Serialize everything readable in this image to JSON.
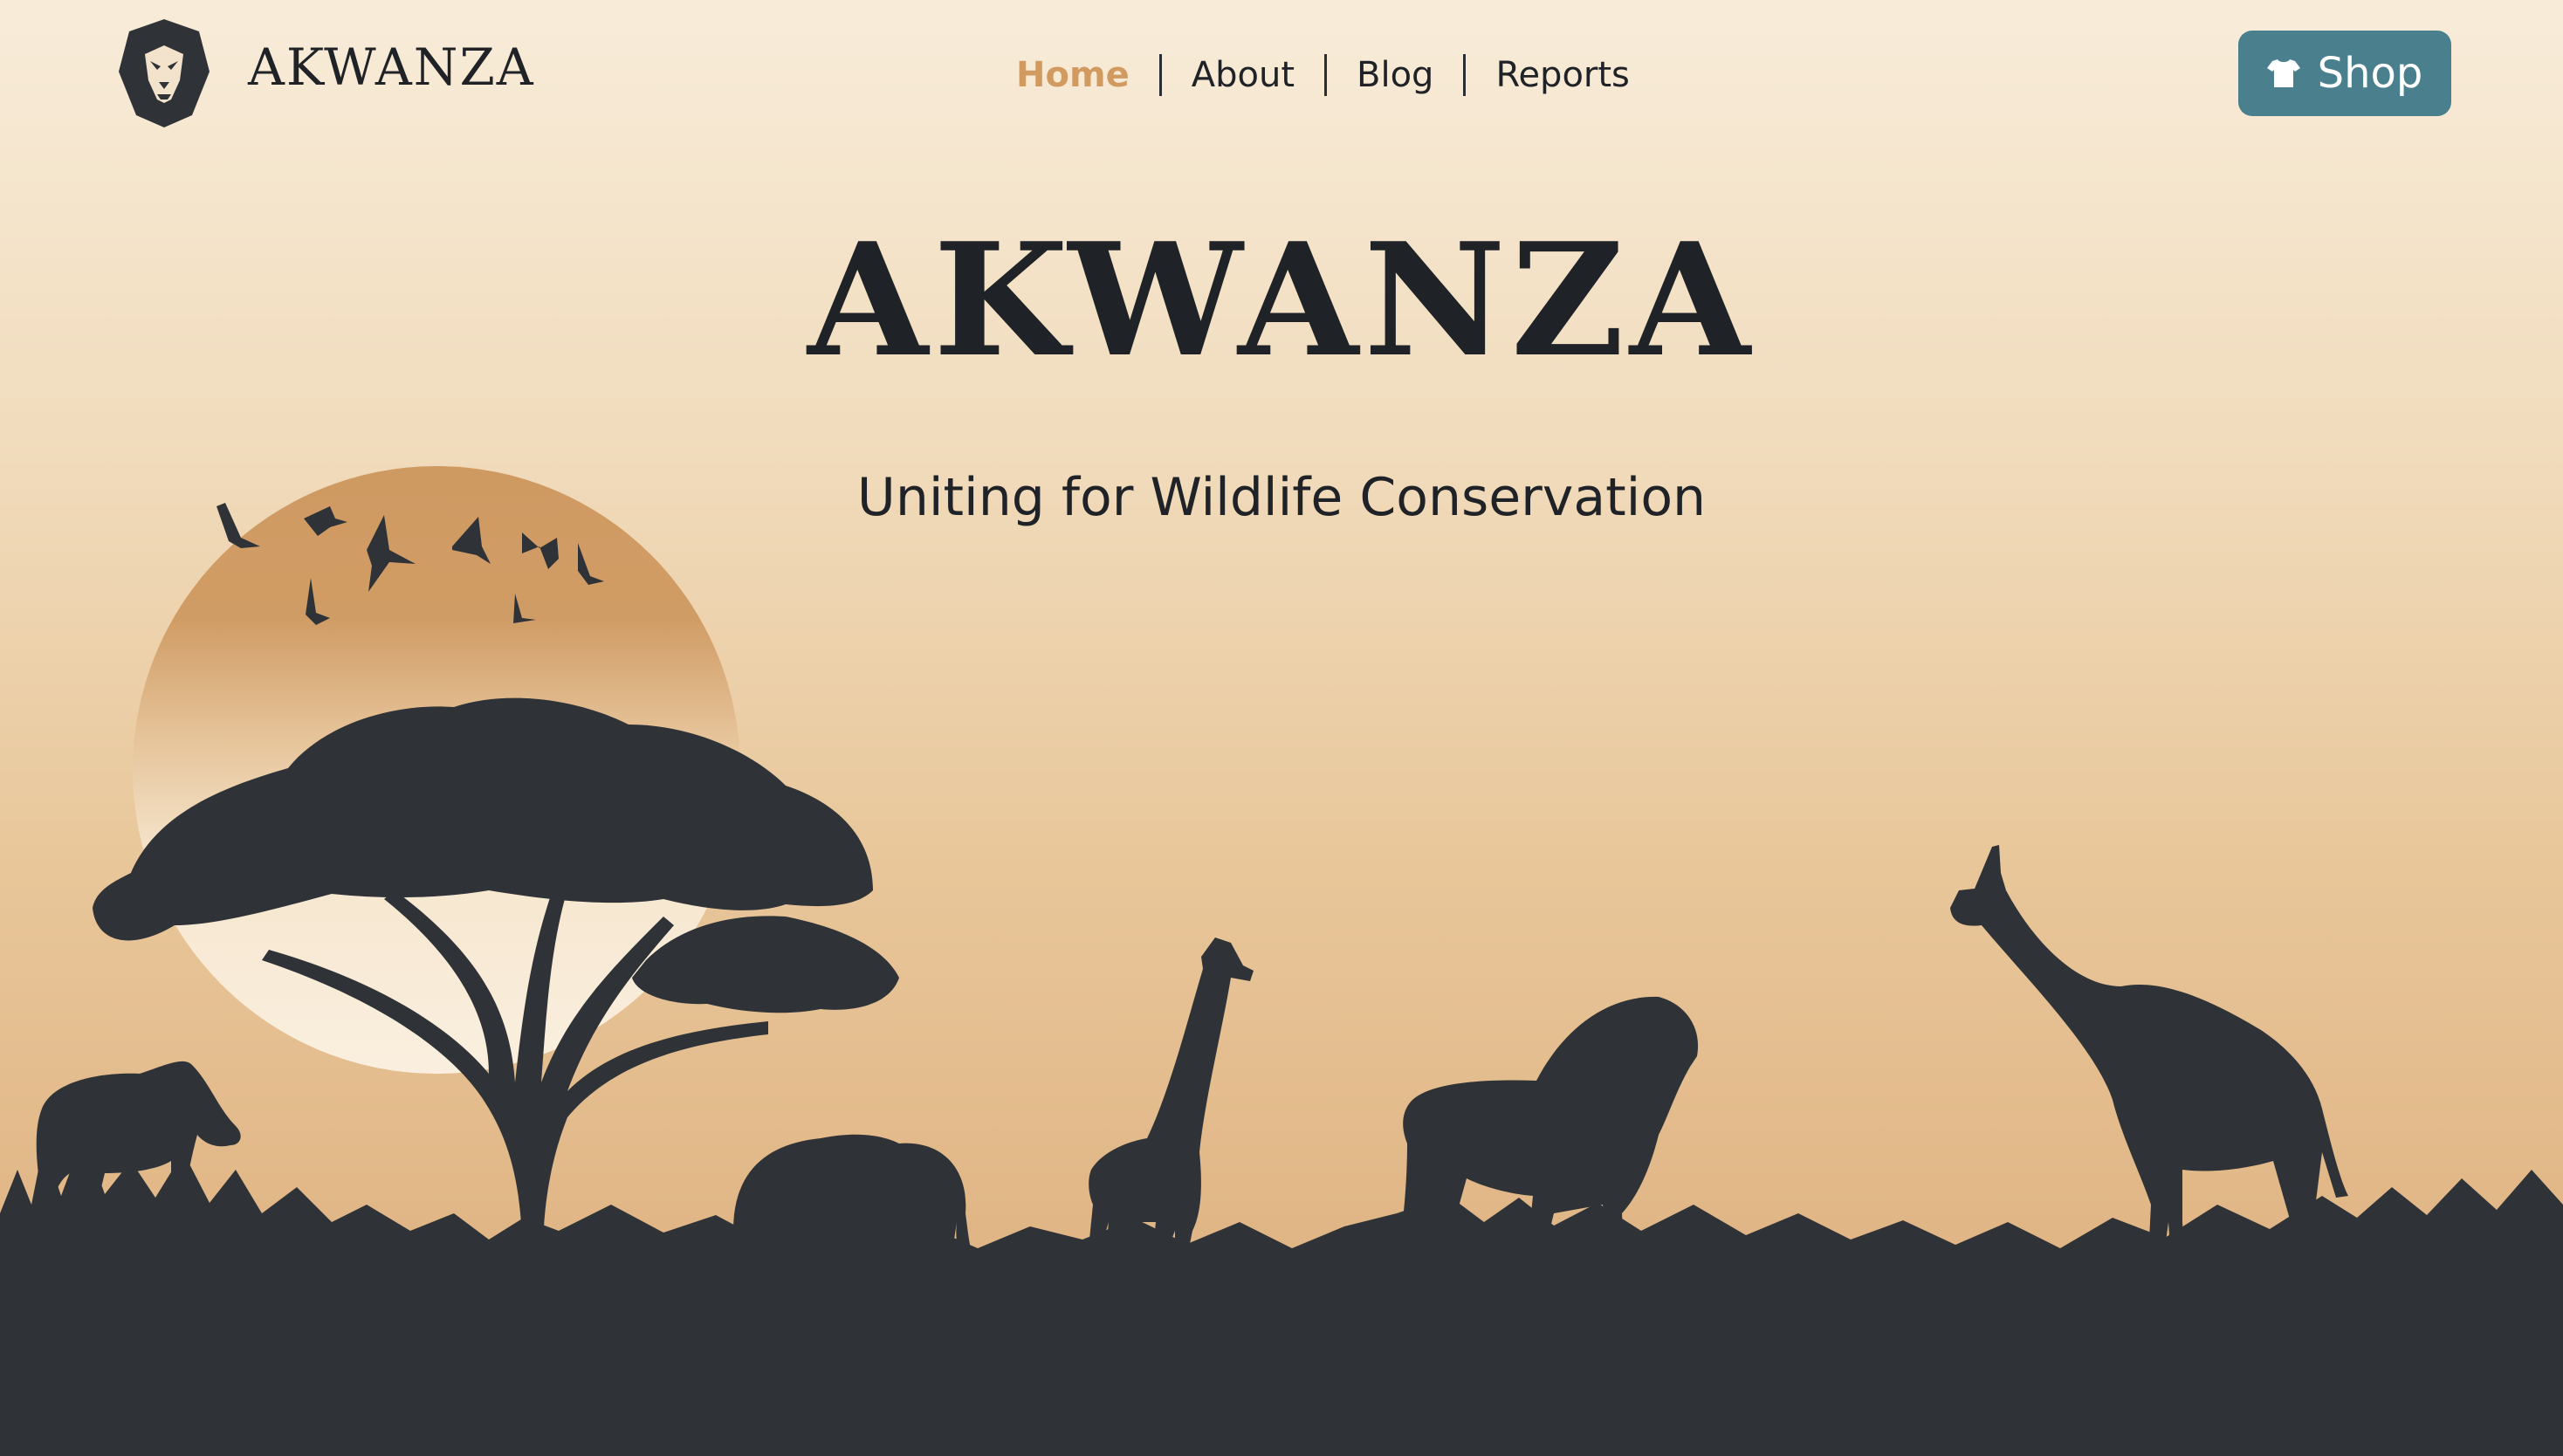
{
  "brand": {
    "name": "AKWANZA",
    "logo_icon": "lion-icon"
  },
  "nav": {
    "items": [
      {
        "label": "Home",
        "active": true
      },
      {
        "label": "About",
        "active": false
      },
      {
        "label": "Blog",
        "active": false
      },
      {
        "label": "Reports",
        "active": false
      }
    ]
  },
  "shop": {
    "label": "Shop",
    "icon": "tshirt-icon"
  },
  "hero": {
    "title": "AKWANZA",
    "subtitle": "Uniting for Wildlife Conservation"
  },
  "colors": {
    "accent": "#d19a60",
    "shop_button": "#4a7f8e",
    "silhouette": "#2f3338",
    "text": "#1f2226"
  }
}
